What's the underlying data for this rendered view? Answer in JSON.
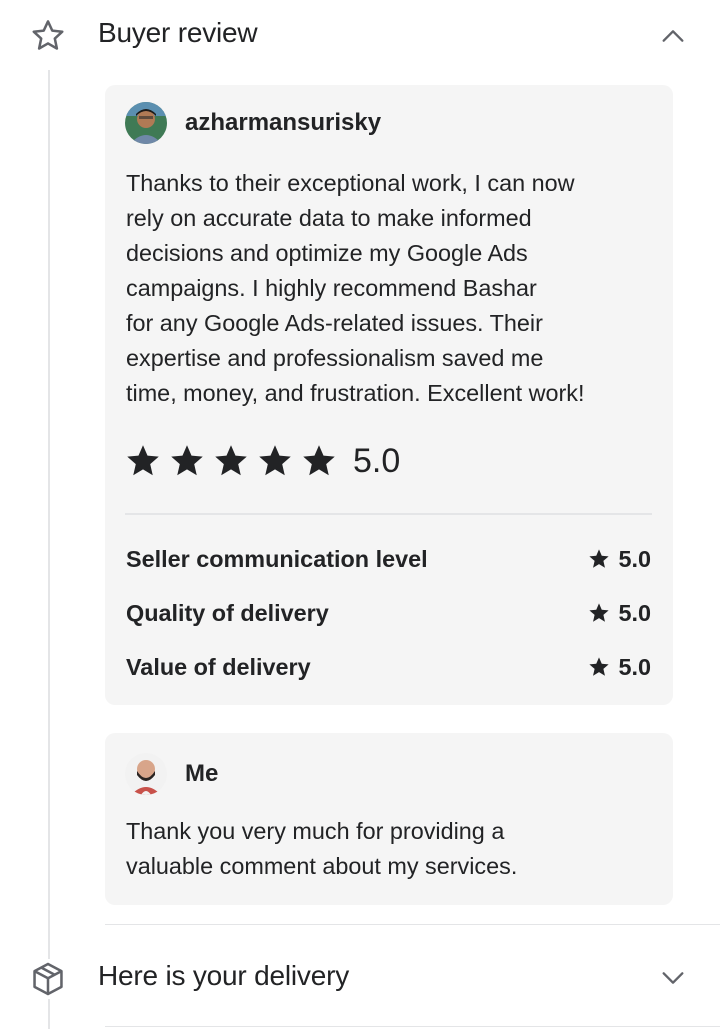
{
  "buyer_review_section": {
    "title": "Buyer review",
    "icon": "star-outline-icon",
    "state": "expanded"
  },
  "review": {
    "author": "azharmansurisky",
    "text": "Thanks to their exceptional work, I can now rely on accurate data to make informed decisions and optimize my Google Ads campaigns. I highly recommend Bashar for any Google Ads-related issues. Their expertise and professionalism saved me time, money, and frustration. Excellent work!",
    "lines": [
      "Thanks to their exceptional work, I can now",
      "rely on accurate data to make informed",
      "decisions and optimize my Google Ads",
      "campaigns. I highly recommend Bashar",
      "for any Google Ads-related issues. Their",
      "expertise and professionalism saved me",
      "time, money, and frustration. Excellent work!"
    ],
    "overall_rating": "5.0",
    "stars": 5,
    "sub_ratings": [
      {
        "label": "Seller communication level",
        "value": "5.0"
      },
      {
        "label": "Quality of delivery",
        "value": "5.0"
      },
      {
        "label": "Value of delivery",
        "value": "5.0"
      }
    ]
  },
  "reply": {
    "author": "Me",
    "lines": [
      "Thank you very much for providing a",
      "valuable comment about my services."
    ]
  },
  "delivery_section": {
    "title": "Here is your delivery",
    "icon": "package-icon",
    "state": "collapsed"
  },
  "colors": {
    "text": "#222325",
    "card_bg": "#f5f5f5",
    "line": "#e4e5e7",
    "icon_gray": "#62646a"
  }
}
